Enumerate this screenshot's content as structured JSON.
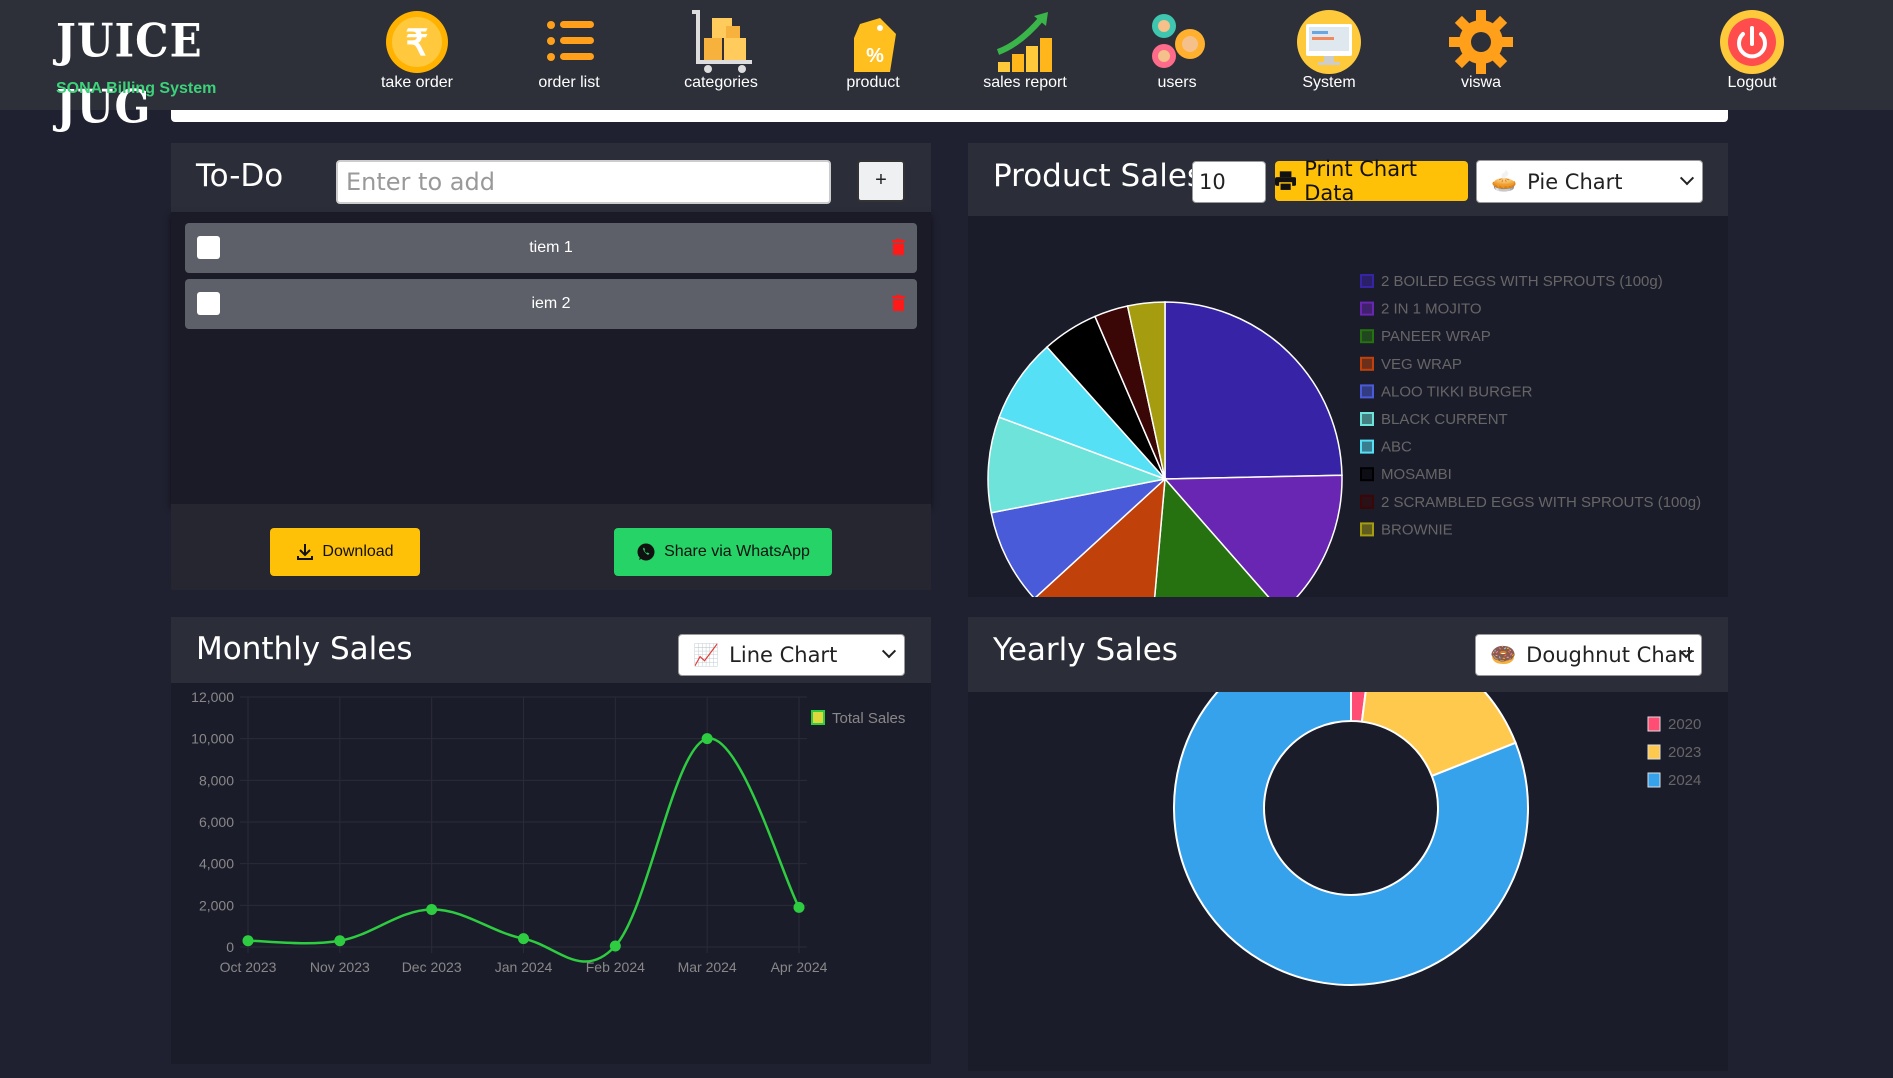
{
  "app": {
    "logo_text": "JUICE JUG",
    "subtitle": "SONA Billing System"
  },
  "nav": [
    {
      "label": "take order",
      "icon": "rupee-coin-icon"
    },
    {
      "label": "order list",
      "icon": "list-icon"
    },
    {
      "label": "categories",
      "icon": "boxes-cart-icon"
    },
    {
      "label": "product",
      "icon": "price-tag-icon"
    },
    {
      "label": "sales report",
      "icon": "growth-chart-icon"
    },
    {
      "label": "users",
      "icon": "users-gears-icon"
    },
    {
      "label": "System",
      "icon": "computer-icon"
    },
    {
      "label": "viswa",
      "icon": "gear-icon"
    },
    {
      "label": "Logout",
      "icon": "power-icon"
    }
  ],
  "todo": {
    "title": "To-Do",
    "placeholder": "Enter to add",
    "add_label": "+",
    "items": [
      {
        "text": "tiem 1",
        "checked": false
      },
      {
        "text": "iem 2",
        "checked": false
      }
    ],
    "download_label": "Download",
    "whatsapp_label": "Share via WhatsApp"
  },
  "product_sales": {
    "title": "Product Sales",
    "count_value": "10",
    "print_label": "Print Chart Data",
    "chart_type_selected": "Pie Chart"
  },
  "monthly_sales": {
    "title": "Monthly Sales",
    "chart_type_selected": "Line Chart"
  },
  "yearly_sales": {
    "title": "Yearly Sales",
    "chart_type_selected": "Doughnut Chart"
  },
  "chart_data": [
    {
      "id": "product_sales",
      "type": "pie",
      "categories": [
        "2 BOILED EGGS WITH SPROUTS (100g)",
        "2 IN 1 MOJITO",
        "PANEER WRAP",
        "VEG WRAP",
        "ALOO TIKKI BURGER",
        "BLACK CURRENT",
        "ABC",
        "MOSAMBI",
        "2 SCRAMBLED EGGS WITH SPROUTS (100g)",
        "BROWNIE"
      ],
      "values": [
        24,
        13.5,
        12.5,
        11.5,
        8.5,
        8.5,
        7.5,
        5,
        3,
        3.3
      ],
      "colors": [
        "#3723a6",
        "#6826b2",
        "#267210",
        "#c0410a",
        "#4a5bd9",
        "#6de3d9",
        "#55e0f5",
        "#000000",
        "#3a0606",
        "#a59c10"
      ],
      "legend": "right"
    },
    {
      "id": "monthly_sales",
      "type": "line",
      "x": [
        "Oct 2023",
        "Nov 2023",
        "Dec 2023",
        "Jan 2024",
        "Feb 2024",
        "Mar 2024",
        "Apr 2024"
      ],
      "series": [
        {
          "name": "Total Sales",
          "values": [
            300,
            300,
            1800,
            400,
            50,
            10000,
            1900
          ],
          "color": "#2ecc40"
        }
      ],
      "ylim": [
        0,
        12000
      ],
      "yticks": [
        "0",
        "2,000",
        "4,000",
        "6,000",
        "8,000",
        "10,000",
        "12,000"
      ],
      "legend": "top-right"
    },
    {
      "id": "yearly_sales",
      "type": "doughnut",
      "categories": [
        "2020",
        "2023",
        "2024"
      ],
      "values": [
        2,
        17,
        81
      ],
      "colors": [
        "#ff4d73",
        "#ffc94d",
        "#36a2eb"
      ],
      "legend": "top-right"
    }
  ]
}
